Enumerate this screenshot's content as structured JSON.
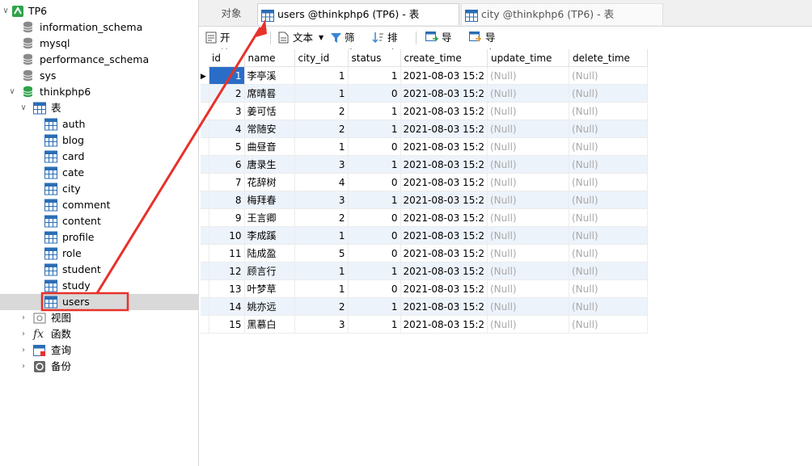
{
  "sidebar": {
    "connection": "TP6",
    "databases": [
      "information_schema",
      "mysql",
      "performance_schema",
      "sys"
    ],
    "active_db": "thinkphp6",
    "tables_group": "表",
    "tables": [
      "auth",
      "blog",
      "card",
      "cate",
      "city",
      "comment",
      "content",
      "profile",
      "role",
      "student",
      "study",
      "users"
    ],
    "groups": [
      "视图",
      "函数",
      "查询",
      "备份"
    ],
    "selected_table": "users"
  },
  "tabs": {
    "objects": "对象",
    "active": "users @thinkphp6 (TP6) - 表",
    "other": "city @thinkphp6 (TP6) - 表"
  },
  "toolbar": {
    "begin_tx": "开始事务",
    "text": "文本",
    "filter": "筛选",
    "sort": "排序",
    "import": "导入",
    "export": "导出"
  },
  "grid": {
    "columns": [
      "id",
      "name",
      "city_id",
      "status",
      "create_time",
      "update_time",
      "delete_time"
    ],
    "rows": [
      {
        "id": "1",
        "name": "李亭溪",
        "city_id": "1",
        "status": "1",
        "create_time": "2021-08-03 15:2",
        "update_time": "(Null)",
        "delete_time": "(Null)"
      },
      {
        "id": "2",
        "name": "席晴晷",
        "city_id": "1",
        "status": "0",
        "create_time": "2021-08-03 15:2",
        "update_time": "(Null)",
        "delete_time": "(Null)"
      },
      {
        "id": "3",
        "name": "姜可恬",
        "city_id": "2",
        "status": "1",
        "create_time": "2021-08-03 15:2",
        "update_time": "(Null)",
        "delete_time": "(Null)"
      },
      {
        "id": "4",
        "name": "常随安",
        "city_id": "2",
        "status": "1",
        "create_time": "2021-08-03 15:2",
        "update_time": "(Null)",
        "delete_time": "(Null)"
      },
      {
        "id": "5",
        "name": "曲昼音",
        "city_id": "1",
        "status": "0",
        "create_time": "2021-08-03 15:2",
        "update_time": "(Null)",
        "delete_time": "(Null)"
      },
      {
        "id": "6",
        "name": "唐录生",
        "city_id": "3",
        "status": "1",
        "create_time": "2021-08-03 15:2",
        "update_time": "(Null)",
        "delete_time": "(Null)"
      },
      {
        "id": "7",
        "name": "花辞树",
        "city_id": "4",
        "status": "0",
        "create_time": "2021-08-03 15:2",
        "update_time": "(Null)",
        "delete_time": "(Null)"
      },
      {
        "id": "8",
        "name": "梅拜春",
        "city_id": "3",
        "status": "1",
        "create_time": "2021-08-03 15:2",
        "update_time": "(Null)",
        "delete_time": "(Null)"
      },
      {
        "id": "9",
        "name": "王言卿",
        "city_id": "2",
        "status": "0",
        "create_time": "2021-08-03 15:2",
        "update_time": "(Null)",
        "delete_time": "(Null)"
      },
      {
        "id": "10",
        "name": "李成蹊",
        "city_id": "1",
        "status": "0",
        "create_time": "2021-08-03 15:2",
        "update_time": "(Null)",
        "delete_time": "(Null)"
      },
      {
        "id": "11",
        "name": "陆成盈",
        "city_id": "5",
        "status": "0",
        "create_time": "2021-08-03 15:2",
        "update_time": "(Null)",
        "delete_time": "(Null)"
      },
      {
        "id": "12",
        "name": "顾言行",
        "city_id": "1",
        "status": "1",
        "create_time": "2021-08-03 15:2",
        "update_time": "(Null)",
        "delete_time": "(Null)"
      },
      {
        "id": "13",
        "name": "叶梦草",
        "city_id": "1",
        "status": "0",
        "create_time": "2021-08-03 15:2",
        "update_time": "(Null)",
        "delete_time": "(Null)"
      },
      {
        "id": "14",
        "name": "姚亦远",
        "city_id": "2",
        "status": "1",
        "create_time": "2021-08-03 15:2",
        "update_time": "(Null)",
        "delete_time": "(Null)"
      },
      {
        "id": "15",
        "name": "黑慕白",
        "city_id": "3",
        "status": "1",
        "create_time": "2021-08-03 15:2",
        "update_time": "(Null)",
        "delete_time": "(Null)"
      }
    ]
  },
  "colors": {
    "annotation": "#e8312a",
    "accent": "#2a6dc8",
    "selected_row": "#d9d9d9"
  }
}
